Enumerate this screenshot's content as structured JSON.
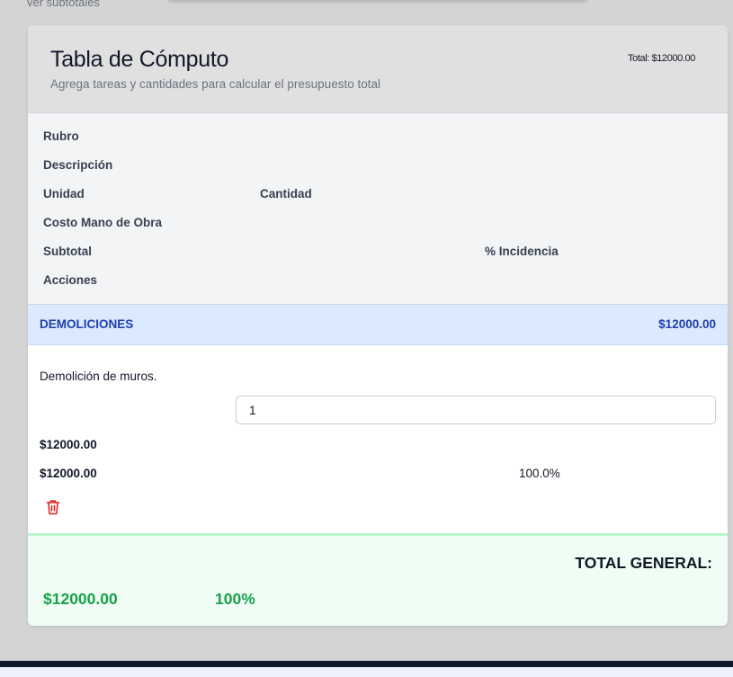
{
  "top_link": "ver subtotales",
  "header": {
    "title": "Tabla de Cómputo",
    "subtitle": "Agrega tareas y cantidades para calcular el presupuesto total",
    "total": "Total: $12000.00"
  },
  "columns": {
    "rubro": "Rubro",
    "descripcion": "Descripción",
    "unidad": "Unidad",
    "cantidad": "Cantidad",
    "costo": "Costo Mano de Obra",
    "subtotal": "Subtotal",
    "incidencia": "% Incidencia",
    "acciones": "Acciones"
  },
  "category": {
    "name": "DEMOLICIONES",
    "total": "$12000.00"
  },
  "item": {
    "descripcion": "Demolición de muros.",
    "cantidad": "1",
    "costo": "$12000.00",
    "subtotal": "$12000.00",
    "incidencia": "100.0%",
    "delete_icon": "trash-icon"
  },
  "footer": {
    "label": "TOTAL GENERAL:",
    "total": "$12000.00",
    "percent": "100%"
  },
  "colors": {
    "category_bg": "#dbeafe",
    "category_text": "#1e40af",
    "footer_bg": "#f0fdf4",
    "footer_value": "#16a34a",
    "delete": "#dc2626"
  }
}
